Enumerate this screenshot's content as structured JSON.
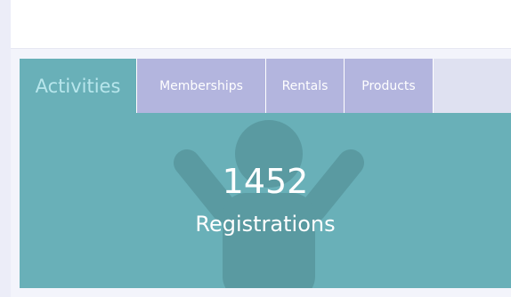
{
  "tabs": [
    {
      "label": "Activities",
      "active": true
    },
    {
      "label": "Memberships",
      "active": false
    },
    {
      "label": "Rentals",
      "active": false
    },
    {
      "label": "Products",
      "active": false
    }
  ],
  "stat": {
    "value": "1452",
    "label": "Registrations",
    "icon": "person-raised-arms-icon"
  },
  "colors": {
    "accent": "#69b0b8",
    "tab_inactive": "#b3b5de",
    "tab_bar": "#dfe1f1",
    "active_tab_text": "#b7e6ec",
    "icon_silhouette": "#5a9aa1"
  }
}
